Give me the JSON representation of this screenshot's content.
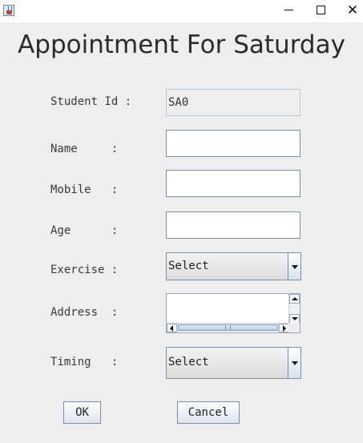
{
  "window": {
    "icon": "java-cup-icon",
    "controls": [
      "minimize-icon",
      "maximize-icon",
      "close-icon"
    ],
    "close_glyph": "✕"
  },
  "heading": "Appointment For Saturday",
  "form": {
    "student_id": {
      "label": "Student Id :",
      "value": "SA0"
    },
    "name": {
      "label": "Name     :",
      "value": ""
    },
    "mobile": {
      "label": "Mobile   :",
      "value": ""
    },
    "age": {
      "label": "Age      :",
      "value": ""
    },
    "exercise": {
      "label": "Exercise :",
      "selected": "Select"
    },
    "address": {
      "label": "Address  :",
      "value": ""
    },
    "timing": {
      "label": "Timing   :",
      "selected": "Select"
    }
  },
  "buttons": {
    "ok": "OK",
    "cancel": "Cancel"
  },
  "colors": {
    "background": "#eeeeee",
    "field_border": "#7a8ea8",
    "scroll_thumb": "#b9cde2"
  }
}
